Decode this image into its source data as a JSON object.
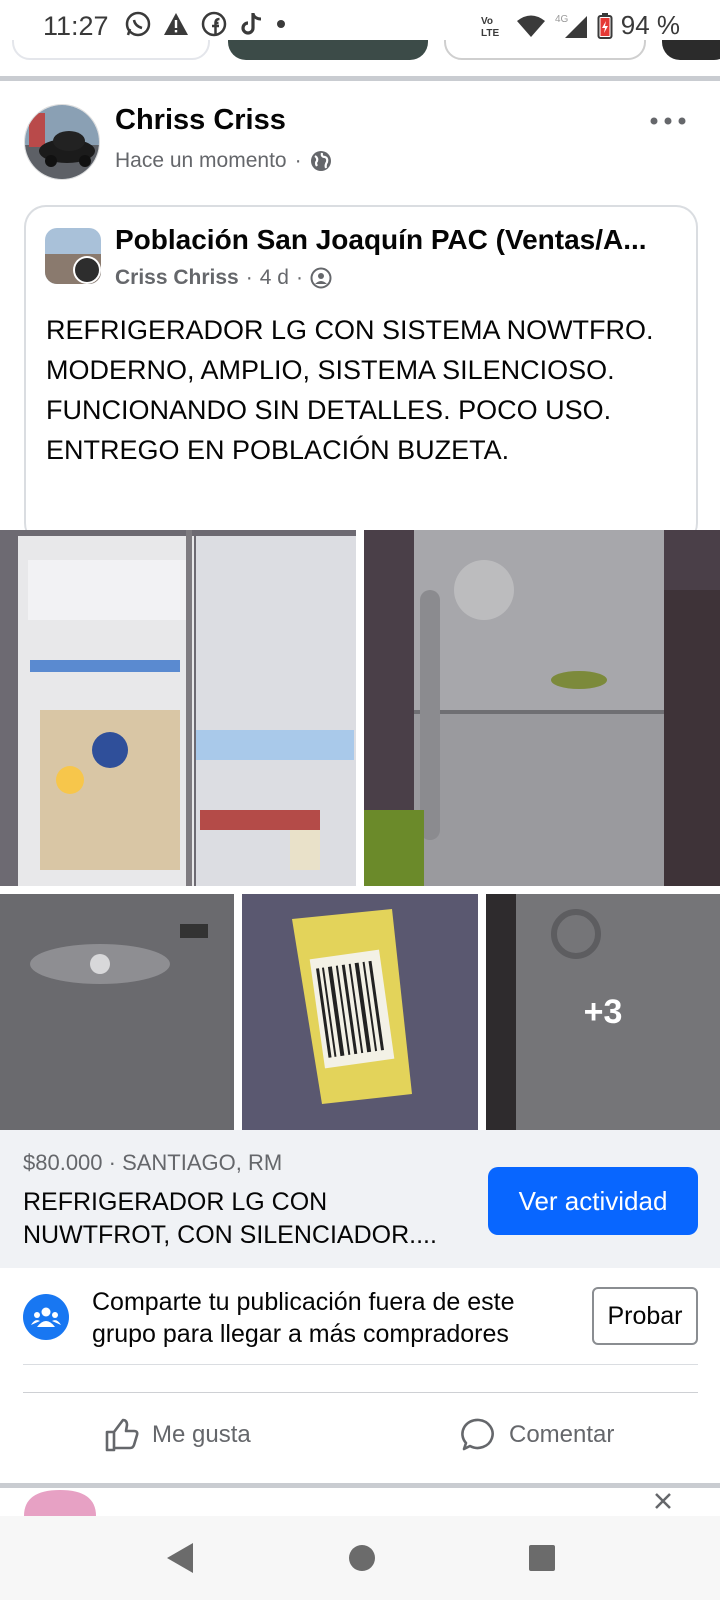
{
  "status_bar": {
    "time": "11:27",
    "battery": "94 %",
    "left_icons": [
      "whatsapp-icon",
      "warning-icon",
      "facebook-icon",
      "tiktok-icon",
      "dot-icon"
    ],
    "right_icons": [
      "volte-icon",
      "wifi-icon",
      "4g-signal-icon",
      "battery-icon"
    ]
  },
  "post": {
    "author": "Chriss Criss",
    "time": "Hace un momento",
    "shared": {
      "group_name": "Población San Joaquín PAC (Ventas/A...",
      "poster": "Criss Chriss",
      "age": "4 d",
      "text": "REFRIGERADOR LG CON SISTEMA NOWTFRO. MODERNO, AMPLIO, SISTEMA SILENCIOSO. FUNCIONANDO SIN DETALLES. POCO USO. ENTREGO EN POBLACIÓN BUZETA."
    },
    "photos": {
      "more_count": "+3"
    },
    "listing": {
      "price_location": "$80.000 · SANTIAGO, RM",
      "title_line1": "REFRIGERADOR LG CON",
      "title_line2": "NUWTFROT, CON SILENCIADOR....",
      "cta": "Ver actividad"
    },
    "share_prompt": {
      "text": "Comparte tu publicación fuera de este grupo para llegar a más compradores",
      "button": "Probar"
    },
    "actions": {
      "like": "Me gusta",
      "comment": "Comentar"
    }
  },
  "colors": {
    "accent": "#0866ff",
    "secondary_text": "#65676b",
    "background": "#ffffff",
    "listing_bg": "#f0f2f5"
  }
}
